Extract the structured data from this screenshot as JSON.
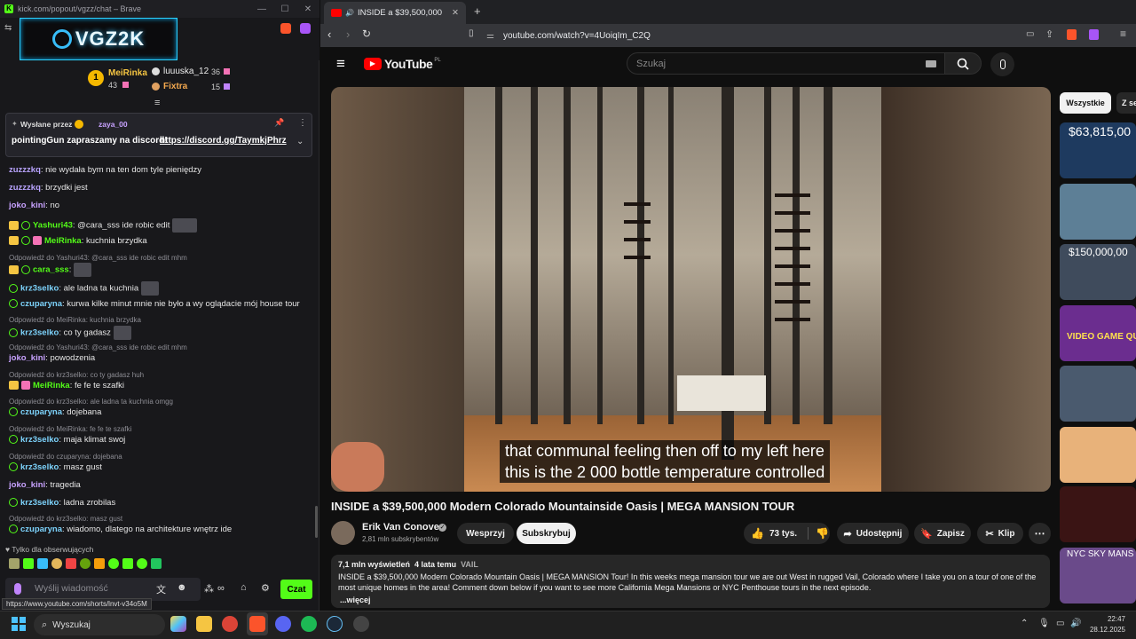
{
  "kick": {
    "window_title": "kick.com/popout/vgzz/chat – Brave",
    "channel_logo_text": "VGZ2K",
    "leaderboard": [
      {
        "rank": "1",
        "name": "MeiRinka",
        "value": "43"
      },
      {
        "name": "luuuska_12",
        "value": "36"
      },
      {
        "name": "Fixtra",
        "value": "15"
      }
    ],
    "pinned": {
      "sent_by_label": "Wysłane przez",
      "sent_by_user": "zaya_00",
      "message_prefix": "pointingGun zapraszamy na discord!",
      "link": "https://discord.gg/TaymkjPhrz"
    },
    "messages": [
      {
        "user": "zuzzzkq",
        "text": ": nie wydała bym na ten dom tyle pieniędzy"
      },
      {
        "user": "zuzzzkq",
        "text": ": brzydki jest"
      },
      {
        "user": "joko_kini",
        "text": ": no"
      },
      {
        "user": "Yashuri43",
        "text": ": @cara_sss ide robic edit"
      },
      {
        "user": "MeiRinka",
        "text": ": kuchnia brzydka"
      },
      {
        "reply": "Odpowiedź do Yashuri43: @cara_sss ide robic edit mhm"
      },
      {
        "user": "cara_sss",
        "text": ":"
      },
      {
        "user": "krz3selko",
        "text": ": ale ladna ta kuchnia"
      },
      {
        "user": "czuparyna",
        "text": ": kurwa kilke minut mnie nie było a wy oglądacie mój house tour"
      },
      {
        "reply": "Odpowiedź do MeiRinka: kuchnia brzydka"
      },
      {
        "user": "krz3selko",
        "text": ": co ty gadasz"
      },
      {
        "reply": "Odpowiedź do Yashuri43: @cara_sss ide robic edit mhm"
      },
      {
        "user": "joko_kini",
        "text": ": powodzenia"
      },
      {
        "reply": "Odpowiedź do krz3selko: co ty gadasz huh"
      },
      {
        "user": "MeiRinka",
        "text": ": fe fe te szafki"
      },
      {
        "reply": "Odpowiedź do krz3selko: ale ladna ta kuchnia omgg"
      },
      {
        "user": "czuparyna",
        "text": ": dojebana"
      },
      {
        "reply": "Odpowiedź do MeiRinka: fe fe te szafki"
      },
      {
        "user": "krz3selko",
        "text": ": maja klimat swoj"
      },
      {
        "reply": "Odpowiedź do czuparyna: dojebana"
      },
      {
        "user": "krz3selko",
        "text": ": masz gust"
      },
      {
        "user": "joko_kini",
        "text": ": tragedia"
      },
      {
        "user": "krz3selko",
        "text": ": ladna zrobilas"
      },
      {
        "reply": "Odpowiedź do krz3selko: masz gust"
      },
      {
        "user": "czuparyna",
        "text": ": wiadomo, dlatego na architekture wnętrz ide"
      }
    ],
    "followers_only": "Tylko dla obserwujących",
    "input_placeholder": "Wyślij wiadomość",
    "send_label": "Czat",
    "status_url": "https://www.youtube.com/shorts/lnvt-v34o5M"
  },
  "browser": {
    "tab_title": "INSIDE a $39,500,000 Modern",
    "url": "youtube.com/watch?v=4UoiqIm_C2Q"
  },
  "youtube": {
    "logo_text": "YouTube",
    "logo_region": "PL",
    "search_placeholder": "Szukaj",
    "subtitle_lines": "that communal feeling then off to my left here\nthis is the 2 000 bottle temperature controlled",
    "title": "INSIDE a $39,500,000 Modern Colorado Mountainside Oasis | MEGA MANSION TOUR",
    "channel_name": "Erik Van Conover",
    "subscribers": "2,81 mln subskrybentów",
    "support_label": "Wesprzyj",
    "subscribe_label": "Subskrybuj",
    "likes": "73 tys.",
    "share_label": "Udostępnij",
    "save_label": "Zapisz",
    "clip_label": "Klip",
    "views": "7,1 mln wyświetleń",
    "age": "4 lata temu",
    "tag": "VAIL",
    "description": "INSIDE a $39,500,000 Modern Colorado Mountain Oasis | MEGA MANSION Tour! In this weeks mega mansion tour we are out West in rugged Vail, Colorado where I take you on a tour of one of the most unique homes in the area! Comment down below if you want to see more California Mega Mansions or NYC Penthouse tours in the next episode.",
    "more_label": "...więcej",
    "chips": [
      "Wszystkie",
      "Z se"
    ],
    "thumb_texts": [
      "$63,815,00",
      "",
      "$150,000,00",
      "VIDEO GAME QUIZ",
      "",
      "",
      "",
      "NYC SKY MANS"
    ]
  },
  "taskbar": {
    "search_label": "Wyszukaj",
    "time": "22:47",
    "date": "28.12.2025"
  },
  "colors": {
    "kick_green": "#53fc18",
    "yt_red": "#ff0000"
  }
}
